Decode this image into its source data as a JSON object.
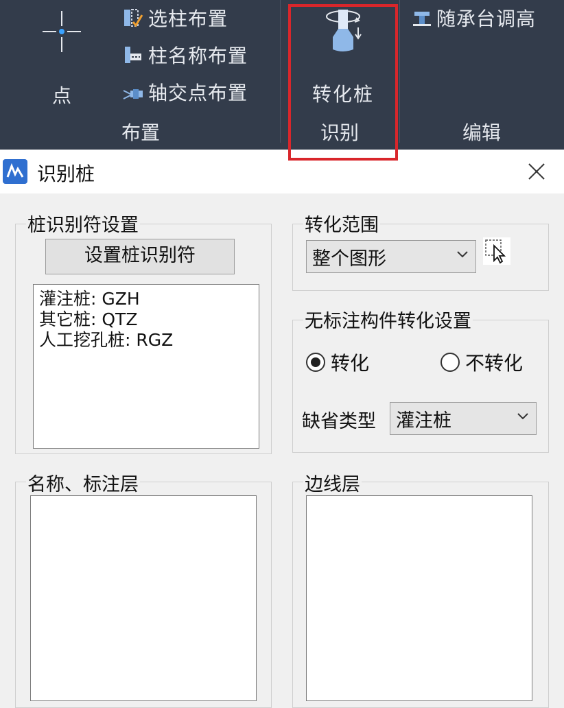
{
  "ribbon": {
    "point_label": "点",
    "items": {
      "select_column_place": "选柱布置",
      "column_name_place": "柱名称布置",
      "axis_intersect_place": "轴交点布置"
    },
    "group_layout": "布置",
    "convert_pile_label": "转化桩",
    "group_recognize": "识别",
    "follow_cap_adjust": "随承台调高",
    "group_edit": "编辑",
    "highlight_color": "#d9262b"
  },
  "dialog": {
    "title": "识别桩",
    "pile_id_settings": {
      "label": "桩识别符设置",
      "button_label": "设置桩识别符",
      "items": [
        "灌注桩: GZH",
        "其它桩: QTZ",
        "人工挖孔桩: RGZ"
      ]
    },
    "convert_range": {
      "label": "转化范围",
      "selected": "整个图形"
    },
    "unmarked": {
      "label": "无标注构件转化设置",
      "option_convert": "转化",
      "option_no_convert": "不转化",
      "selected": "转化",
      "default_type_label": "缺省类型",
      "default_type_value": "灌注桩"
    },
    "name_layer": {
      "label": "名称、标注层"
    },
    "edge_layer": {
      "label": "边线层"
    }
  }
}
